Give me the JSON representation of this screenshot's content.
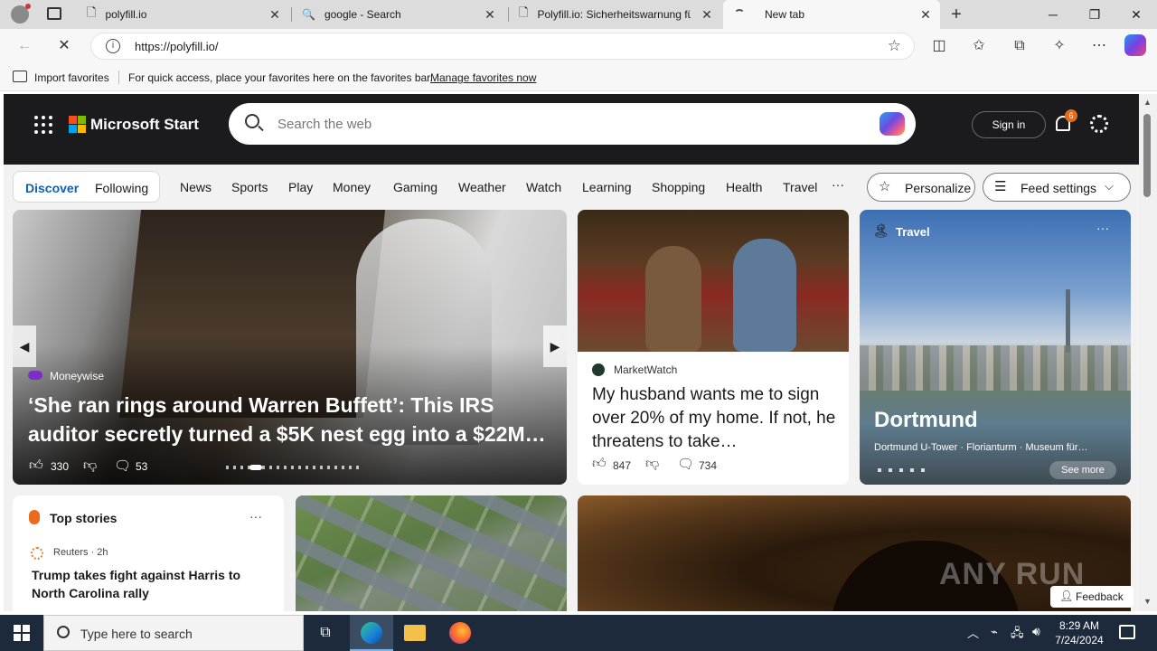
{
  "browser": {
    "tabs": [
      {
        "title": "polyfill.io"
      },
      {
        "title": "google - Search"
      },
      {
        "title": "Polyfill.io: Sicherheitswarnung für"
      },
      {
        "title": "New tab"
      }
    ],
    "address": "https://polyfill.io/",
    "favbar": {
      "import_label": "Import favorites",
      "hint": "For quick access, place your favorites here on the favorites bar.",
      "manage_link": "Manage favorites now"
    }
  },
  "msstart": {
    "brand": "Microsoft Start",
    "search_placeholder": "Search the web",
    "sign_in": "Sign in",
    "notification_count": "6",
    "feed_tabs": {
      "discover": "Discover",
      "following": "Following"
    },
    "nav": [
      "News",
      "Sports",
      "Play",
      "Money",
      "Gaming",
      "Weather",
      "Watch",
      "Learning",
      "Shopping",
      "Health",
      "Travel"
    ],
    "more": "···",
    "personalize": "Personalize",
    "feed_settings": "Feed settings"
  },
  "hero": {
    "source": "Moneywise",
    "headline": "‘She ran rings around Warren Buffett’: This IRS auditor secretly turned a $5K nest egg into a $22M…",
    "likes": "330",
    "comments": "53"
  },
  "marketwatch": {
    "source": "MarketWatch",
    "headline": "My husband wants me to sign over 20% of my home. If not, he threatens to take…",
    "likes": "847",
    "comments": "734"
  },
  "travel": {
    "label": "Travel",
    "city": "Dortmund",
    "subtitle": "Dortmund U-Tower · Florianturm · Museum für…",
    "see_more": "See more"
  },
  "top_stories": {
    "heading": "Top stories",
    "source": "Reuters · 2h",
    "headline": "Trump takes fight against Harris to North Carolina rally"
  },
  "watermark": "ANY RUN",
  "feedback": "Feedback",
  "taskbar": {
    "search_placeholder": "Type here to search",
    "time": "8:29 AM",
    "date": "7/24/2024"
  }
}
